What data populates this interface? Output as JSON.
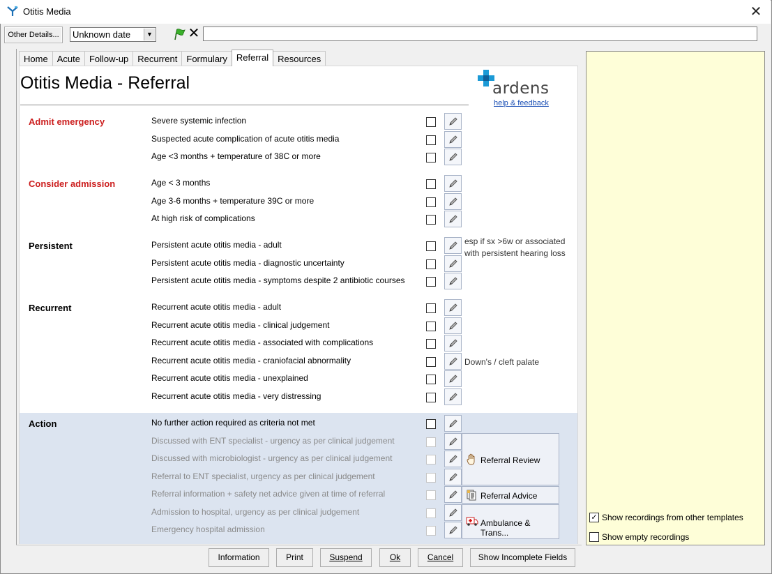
{
  "window": {
    "title": "Otitis Media"
  },
  "toolbar": {
    "other_details": "Other Details...",
    "date_value": "Unknown date"
  },
  "tabs": [
    {
      "label": "Home"
    },
    {
      "label": "Acute"
    },
    {
      "label": "Follow-up"
    },
    {
      "label": "Recurrent"
    },
    {
      "label": "Formulary"
    },
    {
      "label": "Referral"
    },
    {
      "label": "Resources"
    }
  ],
  "active_tab": "Referral",
  "page": {
    "title": "Otitis Media - Referral",
    "logo": "ardens",
    "help_link": "help & feedback"
  },
  "sections": {
    "admit": {
      "title": "Admit emergency",
      "rows": [
        "Severe systemic infection",
        "Suspected acute complication of acute otitis media",
        "Age <3 months + temperature of 38C or more"
      ]
    },
    "consider": {
      "title": "Consider admission",
      "rows": [
        "Age < 3 months",
        "Age 3-6 months + temperature 39C or more",
        "At high risk of complications"
      ]
    },
    "persistent": {
      "title": "Persistent",
      "rows": [
        "Persistent acute otitis media - adult",
        "Persistent acute otitis media - diagnostic uncertainty",
        "Persistent acute otitis media - symptoms despite 2 antibiotic courses"
      ],
      "note_line1": "esp if sx >6w or associated",
      "note_line2": "with persistent hearing loss"
    },
    "recurrent": {
      "title": "Recurrent",
      "rows": [
        "Recurrent acute otitis media - adult",
        "Recurrent acute otitis media - clinical judgement",
        "Recurrent acute otitis media - associated with complications",
        "Recurrent acute otitis media - craniofacial abnormality",
        "Recurrent acute otitis media - unexplained",
        "Recurrent acute otitis media - very distressing"
      ],
      "note": "Down's / cleft palate"
    },
    "action": {
      "title": "Action",
      "rows": [
        "No further action required as criteria not met",
        "Discussed with ENT specialist - urgency as per clinical judgement",
        "Discussed with microbiologist - urgency as per clinical judgement",
        "Referral to ENT specialist, urgency as per clinical judgement",
        "Referral information + safety net advice given at time of referral",
        "Admission to hospital, urgency as per clinical judgement",
        "Emergency hospital admission"
      ]
    }
  },
  "action_buttons": {
    "referral_review": "Referral Review",
    "referral_advice": "Referral Advice",
    "ambulance": "Ambulance & Trans..."
  },
  "bottom_buttons": {
    "information": "Information",
    "print": "Print",
    "suspend": "Suspend",
    "ok": "Ok",
    "cancel": "Cancel",
    "show_incomplete": "Show Incomplete Fields"
  },
  "right_panel": {
    "show_other": "Show recordings from other templates",
    "show_other_checked": true,
    "show_empty": "Show empty recordings",
    "show_empty_checked": false
  },
  "colors": {
    "section_red": "#cc1f1f",
    "logo_blue": "#1b9ad6",
    "panel_yellow": "#fefed8",
    "action_bg": "#dce4f0"
  }
}
